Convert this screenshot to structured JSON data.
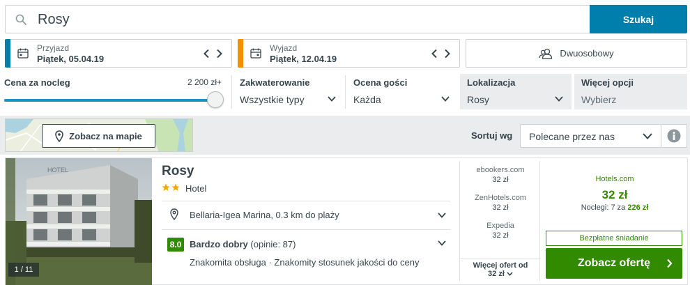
{
  "search": {
    "value": "Rosy",
    "button_label": "Szukaj"
  },
  "checkin": {
    "label": "Przyjazd",
    "value": "Piątek, 05.04.19",
    "accent": "#007fad"
  },
  "checkout": {
    "label": "Wyjazd",
    "value": "Piątek, 12.04.19",
    "accent": "#f48f00"
  },
  "room": {
    "label": "Dwuosobowy"
  },
  "filters": {
    "price": {
      "label": "Cena za nocleg",
      "max": "2 200 zł+",
      "level_fraction": 1.0
    },
    "accommodation": {
      "label": "Zakwaterowanie",
      "value": "Wszystkie typy"
    },
    "guest_rating": {
      "label": "Ocena gości",
      "value": "Każda"
    },
    "location": {
      "label": "Lokalizacja",
      "value": "Rosy"
    },
    "more": {
      "label": "Więcej opcji",
      "value": "Wybierz"
    }
  },
  "map": {
    "button_label": "Zobacz na mapie"
  },
  "sort": {
    "label": "Sortuj wg",
    "value": "Polecane przez nas"
  },
  "hotel": {
    "name": "Rosy",
    "stars": 2,
    "type": "Hotel",
    "image_counter": "1 / 11",
    "location": "Bellaria-Igea Marina, 0.3 km do plaży",
    "rating_score": "8.0",
    "rating_label": "Bardzo dobry",
    "rating_count": "(opinie: 87)",
    "highlights": "Znakomita obsługa · Znakomity stosunek jakości do ceny"
  },
  "offers": [
    {
      "provider": "ebookers.com",
      "price": "32 zł"
    },
    {
      "provider": "ZenHotels.com",
      "price": "32 zł"
    },
    {
      "provider": "Expedia",
      "price": "32 zł"
    }
  ],
  "more_offers": {
    "label": "Więcej ofert od",
    "price": "32 zł"
  },
  "best_offer": {
    "provider": "Hotels.com",
    "price": "32 zł",
    "nights_label": "Noclegi: 7 za",
    "nights_total": "226 zł",
    "badge": "Bezpłatne śniadanie",
    "cta_label": "Zobacz ofertę"
  },
  "colors": {
    "primary": "#007fad",
    "green": "#328a00",
    "text": "#37454d"
  }
}
